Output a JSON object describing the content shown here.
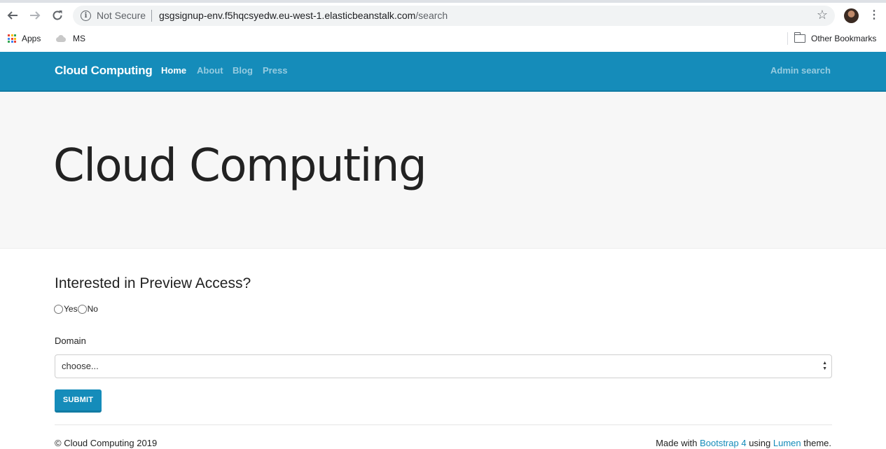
{
  "browser": {
    "back_icon": "arrow-left-icon",
    "forward_icon": "arrow-right-icon",
    "reload_icon": "reload-icon",
    "security_text": "Not Secure",
    "url_host": "gsgsignup-env.f5hqcsyedw.eu-west-1.elasticbeanstalk.com",
    "url_path": "/search",
    "bookmarks": [
      {
        "label": "Apps",
        "icon": "apps-grid-icon"
      },
      {
        "label": "MS",
        "icon": "cloud-icon"
      }
    ],
    "other_bookmarks": "Other Bookmarks"
  },
  "navbar": {
    "brand": "Cloud Computing",
    "links": [
      {
        "label": "Home",
        "active": true
      },
      {
        "label": "About",
        "active": false
      },
      {
        "label": "Blog",
        "active": false
      },
      {
        "label": "Press",
        "active": false
      }
    ],
    "right_link": "Admin search",
    "color": "#158cba"
  },
  "jumbotron": {
    "title": "Cloud Computing"
  },
  "form": {
    "heading": "Interested in Preview Access?",
    "radio_options": [
      "Yes",
      "No"
    ],
    "domain_label": "Domain",
    "domain_selected": "choose...",
    "submit_label": "SUBMIT"
  },
  "footer": {
    "copyright": "© Cloud Computing 2019",
    "made_with_prefix": "Made with ",
    "bootstrap_link": "Bootstrap 4",
    "using_text": " using ",
    "lumen_link": "Lumen",
    "suffix": " theme."
  }
}
